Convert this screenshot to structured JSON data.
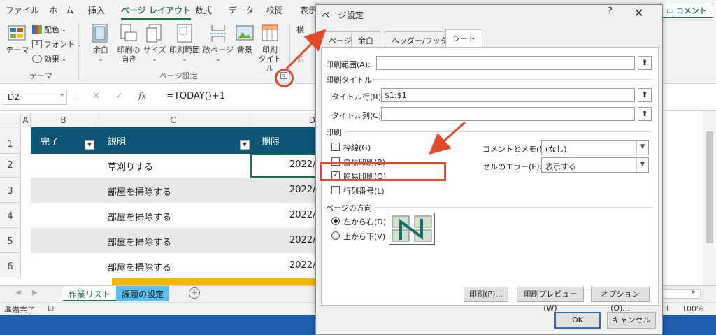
{
  "ribbon": {
    "tabs": [
      "ファイル",
      "ホーム",
      "挿入",
      "ページ レイアウト",
      "数式",
      "データ",
      "校閲",
      "表示"
    ],
    "active_tab": "ページ レイアウト",
    "comment_button": "コメント",
    "theme": {
      "theme_label": "テーマ",
      "colors_label": "配色",
      "fonts_label": "フォント",
      "effects_label": "効果",
      "group_label": "テーマ"
    },
    "page_setup": {
      "margins": "余白",
      "orientation_1": "印刷の",
      "orientation_2": "向き",
      "size": "サイズ",
      "print_area": "印刷範囲",
      "breaks": "改ページ",
      "background": "背景",
      "print_titles_1": "印刷",
      "print_titles_2": "タイトル",
      "group_label": "ページ設定"
    },
    "partial_right": "横",
    "partial_right_2": "拡"
  },
  "formula_bar": {
    "name_box": "D2",
    "fx": "fx",
    "formula": "=TODAY()+1"
  },
  "grid": {
    "columns": [
      "A",
      "B",
      "C",
      "D"
    ],
    "rows": [
      "1",
      "2",
      "3",
      "4",
      "5",
      "6"
    ],
    "header": {
      "done": "完了",
      "description": "説明",
      "due": "期限"
    },
    "data": [
      {
        "description": "草刈りする",
        "due": "2022/"
      },
      {
        "description": "部屋を掃除する",
        "due": "2022/"
      },
      {
        "description": "部屋を掃除する",
        "due": "2022/"
      },
      {
        "description": "部屋を掃除する",
        "due": "2022/"
      },
      {
        "description": "部屋を掃除する",
        "due": "2022/"
      }
    ]
  },
  "sheets": {
    "tabs": [
      "作業リスト",
      "課題の設定"
    ]
  },
  "status": {
    "ready": "準備完了",
    "zoom": "100%"
  },
  "dialog": {
    "title": "ページ設定",
    "help": "?",
    "close": "✕",
    "tabs": [
      "ページ",
      "余白",
      "ヘッダー/フッター",
      "シート"
    ],
    "active_tab": "シート",
    "print_area_label": "印刷範囲(A):",
    "print_area_value": "",
    "print_titles_label": "印刷タイトル",
    "title_rows_label": "タイトル行(R):",
    "title_rows_value": "$1:$1",
    "title_cols_label": "タイトル列(C):",
    "title_cols_value": "",
    "print_section": "印刷",
    "gridlines": "枠線(G)",
    "black_white": "白黒印刷(B)",
    "draft_quality": "簡易印刷(Q)",
    "row_col_headings": "行列番号(L)",
    "comments_label": "コメントとメモ(M):",
    "comments_value": "(なし)",
    "cell_errors_label": "セルのエラー(E):",
    "cell_errors_value": "表示する",
    "page_order_label": "ページの方向",
    "left_to_right": "左から右(D)",
    "top_to_bottom": "上から下(V)",
    "print_button": "印刷(P)...",
    "preview_button": "印刷プレビュー(W)",
    "options_button": "オプション(O)...",
    "ok_button": "OK",
    "cancel_button": "キャンセル"
  },
  "colors": {
    "excel_green": "#217346",
    "table_header": "#0e5576",
    "highlight": "#e04a2a"
  }
}
